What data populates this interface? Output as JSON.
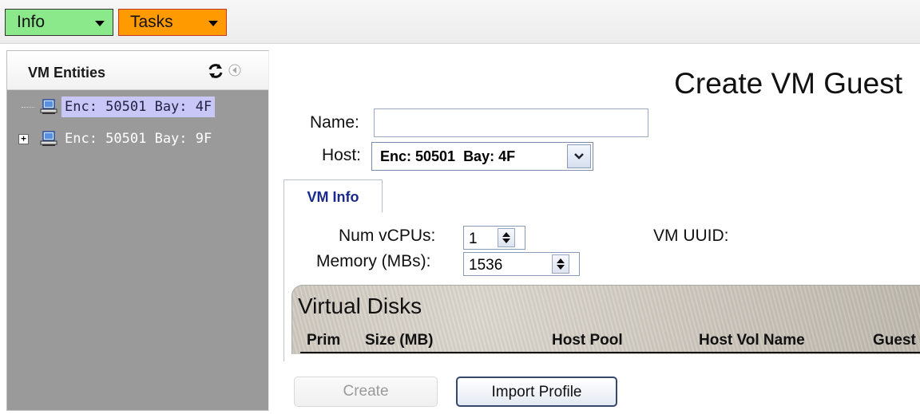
{
  "toolbar": {
    "menus": [
      {
        "label": "Info",
        "color": "#8be88b"
      },
      {
        "label": "Tasks",
        "color": "#ff9a00"
      }
    ]
  },
  "sidebar": {
    "title": "VM Entities",
    "icons": [
      "refresh-icon",
      "collapse-left-icon"
    ],
    "tree": [
      {
        "label": "Enc: 50501 Bay: 4F",
        "selected": true,
        "expandable": false,
        "icon": "host-computer-icon"
      },
      {
        "label": "Enc: 50501 Bay: 9F",
        "selected": false,
        "expandable": true,
        "icon": "host-computer-icon"
      }
    ]
  },
  "main": {
    "title": "Create VM Guest",
    "name_label": "Name:",
    "name_value": "",
    "host_label": "Host:",
    "host_value": "Enc: 50501  Bay: 4F",
    "tabs": [
      {
        "label": "VM Info",
        "active": true
      }
    ],
    "vm_info": {
      "num_vcpus_label": "Num vCPUs:",
      "num_vcpus_value": "1",
      "memory_label": "Memory (MBs):",
      "memory_value": "1536",
      "vm_uuid_label": "VM UUID:"
    },
    "virtual_disks": {
      "title": "Virtual Disks",
      "columns": [
        "Prim",
        "Size (MB)",
        "Host Pool",
        "Host Vol Name",
        "Guest"
      ]
    },
    "buttons": {
      "create_label": "Create",
      "create_enabled": false,
      "import_label": "Import Profile"
    }
  },
  "colors": {
    "sidebar_bg": "#9a9a9a",
    "selection": "#c9c7f7",
    "tab_text": "#1a2a8a",
    "button_border": "#35476d"
  }
}
